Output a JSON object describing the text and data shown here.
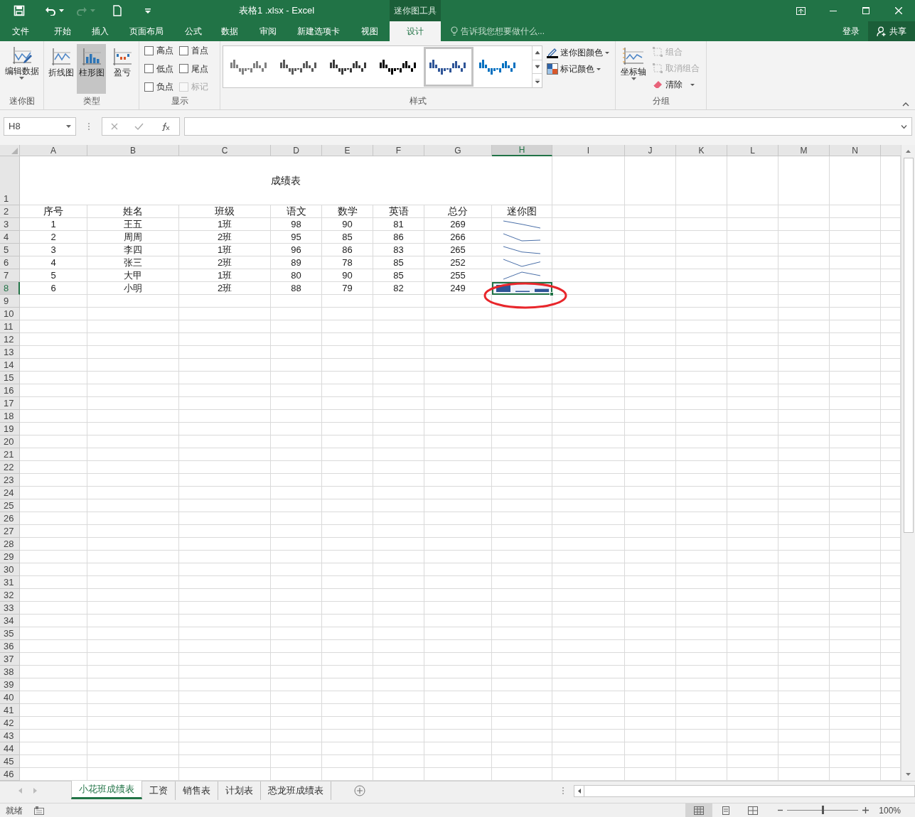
{
  "window": {
    "title": "表格1 .xlsx - Excel",
    "context_label": "迷你图工具"
  },
  "menu_tabs": [
    {
      "label": "文件",
      "selected": false
    },
    {
      "label": "开始",
      "selected": false
    },
    {
      "label": "插入",
      "selected": false
    },
    {
      "label": "页面布局",
      "selected": false
    },
    {
      "label": "公式",
      "selected": false
    },
    {
      "label": "数据",
      "selected": false
    },
    {
      "label": "审阅",
      "selected": false
    },
    {
      "label": "新建选项卡",
      "selected": false
    },
    {
      "label": "视图",
      "selected": false
    },
    {
      "label": "设计",
      "selected": true
    }
  ],
  "tell_me": {
    "placeholder": "告诉我您想要做什么..."
  },
  "account": {
    "sign_in": "登录",
    "share": "共享"
  },
  "ribbon": {
    "groups": [
      {
        "name": "迷你图",
        "kind": "data",
        "buttons": [
          {
            "label": "编辑数据"
          }
        ]
      },
      {
        "name": "类型",
        "kind": "type",
        "options": [
          {
            "label": "折线图",
            "selected": false
          },
          {
            "label": "柱形图",
            "selected": true
          },
          {
            "label": "盈亏",
            "selected": false
          }
        ]
      },
      {
        "name": "显示",
        "kind": "show",
        "checkboxes": [
          {
            "label": "高点",
            "checked": false,
            "disabled": false
          },
          {
            "label": "首点",
            "checked": false,
            "disabled": false
          },
          {
            "label": "低点",
            "checked": false,
            "disabled": false
          },
          {
            "label": "尾点",
            "checked": false,
            "disabled": false
          },
          {
            "label": "负点",
            "checked": false,
            "disabled": false
          },
          {
            "label": "标记",
            "checked": false,
            "disabled": true
          }
        ]
      },
      {
        "name": "样式",
        "kind": "style",
        "styles": [
          {
            "color": "#808080",
            "selected": false
          },
          {
            "color": "#595959",
            "selected": false
          },
          {
            "color": "#3a3a3a",
            "selected": false
          },
          {
            "color": "#000000",
            "selected": false
          },
          {
            "color": "#2f5597",
            "selected": true
          },
          {
            "color": "#0070c0",
            "selected": false
          }
        ],
        "buttons": [
          {
            "label": "迷你图颜色"
          },
          {
            "label": "标记颜色"
          }
        ]
      },
      {
        "name": "分组",
        "kind": "group",
        "axis": {
          "label": "坐标轴"
        },
        "buttons": [
          {
            "label": "组合",
            "disabled": true
          },
          {
            "label": "取消组合",
            "disabled": true
          },
          {
            "label": "清除",
            "disabled": false
          }
        ]
      }
    ]
  },
  "formula_bar": {
    "name_box": "H8"
  },
  "sheet": {
    "columns": [
      {
        "label": "A",
        "selected": false
      },
      {
        "label": "B",
        "selected": false
      },
      {
        "label": "C",
        "selected": false
      },
      {
        "label": "D",
        "selected": false
      },
      {
        "label": "E",
        "selected": false
      },
      {
        "label": "F",
        "selected": false
      },
      {
        "label": "G",
        "selected": false
      },
      {
        "label": "H",
        "selected": true
      },
      {
        "label": "I",
        "selected": false
      },
      {
        "label": "J",
        "selected": false
      },
      {
        "label": "K",
        "selected": false
      },
      {
        "label": "L",
        "selected": false
      },
      {
        "label": "M",
        "selected": false
      },
      {
        "label": "N",
        "selected": false
      }
    ],
    "row_numbers": [
      {
        "label": "1",
        "selected": false
      },
      {
        "label": "2",
        "selected": false
      },
      {
        "label": "3",
        "selected": false
      },
      {
        "label": "4",
        "selected": false
      },
      {
        "label": "5",
        "selected": false
      },
      {
        "label": "6",
        "selected": false
      },
      {
        "label": "7",
        "selected": false
      },
      {
        "label": "8",
        "selected": true
      },
      {
        "label": "9",
        "selected": false
      },
      {
        "label": "10",
        "selected": false
      },
      {
        "label": "11",
        "selected": false
      },
      {
        "label": "12",
        "selected": false
      },
      {
        "label": "13",
        "selected": false
      },
      {
        "label": "14",
        "selected": false
      },
      {
        "label": "15",
        "selected": false
      },
      {
        "label": "16",
        "selected": false
      },
      {
        "label": "17",
        "selected": false
      },
      {
        "label": "18",
        "selected": false
      },
      {
        "label": "19",
        "selected": false
      },
      {
        "label": "20",
        "selected": false
      },
      {
        "label": "21",
        "selected": false
      },
      {
        "label": "22",
        "selected": false
      },
      {
        "label": "23",
        "selected": false
      },
      {
        "label": "24",
        "selected": false
      },
      {
        "label": "25",
        "selected": false
      },
      {
        "label": "26",
        "selected": false
      },
      {
        "label": "27",
        "selected": false
      },
      {
        "label": "28",
        "selected": false
      },
      {
        "label": "29",
        "selected": false
      },
      {
        "label": "30",
        "selected": false
      },
      {
        "label": "31",
        "selected": false
      },
      {
        "label": "32",
        "selected": false
      },
      {
        "label": "33",
        "selected": false
      },
      {
        "label": "34",
        "selected": false
      },
      {
        "label": "35",
        "selected": false
      },
      {
        "label": "36",
        "selected": false
      },
      {
        "label": "37",
        "selected": false
      },
      {
        "label": "38",
        "selected": false
      },
      {
        "label": "39",
        "selected": false
      },
      {
        "label": "40",
        "selected": false
      },
      {
        "label": "41",
        "selected": false
      },
      {
        "label": "42",
        "selected": false
      },
      {
        "label": "43",
        "selected": false
      },
      {
        "label": "44",
        "selected": false
      },
      {
        "label": "45",
        "selected": false
      },
      {
        "label": "46",
        "selected": false
      }
    ],
    "title": "成绩表",
    "header": [
      "序号",
      "姓名",
      "班级",
      "语文",
      "数学",
      "英语",
      "总分",
      "迷你图"
    ],
    "rows": [
      {
        "cells": [
          "1",
          "王五",
          "1班",
          "98",
          "90",
          "81",
          "269"
        ],
        "sparkline": {
          "kind": "line",
          "active": false
        }
      },
      {
        "cells": [
          "2",
          "周周",
          "2班",
          "95",
          "85",
          "86",
          "266"
        ],
        "sparkline": {
          "kind": "line",
          "active": false
        }
      },
      {
        "cells": [
          "3",
          "李四",
          "1班",
          "96",
          "86",
          "83",
          "265"
        ],
        "sparkline": {
          "kind": "line",
          "active": false
        }
      },
      {
        "cells": [
          "4",
          "张三",
          "2班",
          "89",
          "78",
          "85",
          "252"
        ],
        "sparkline": {
          "kind": "line",
          "active": false
        }
      },
      {
        "cells": [
          "5",
          "大甲",
          "1班",
          "80",
          "90",
          "85",
          "255"
        ],
        "sparkline": {
          "kind": "line",
          "active": false
        }
      },
      {
        "cells": [
          "6",
          "小明",
          "2班",
          "88",
          "79",
          "82",
          "249"
        ],
        "sparkline": {
          "kind": "column",
          "active": true
        }
      }
    ],
    "highlight": {
      "color": "#e8262b"
    }
  },
  "sheet_tabs": [
    {
      "label": "小花班成绩表",
      "selected": true
    },
    {
      "label": "工资",
      "selected": false
    },
    {
      "label": "销售表",
      "selected": false
    },
    {
      "label": "计划表",
      "selected": false
    },
    {
      "label": "恐龙班成绩表",
      "selected": false
    }
  ],
  "status": {
    "text": "就绪",
    "views": [
      {
        "kind": "normal",
        "selected": true
      },
      {
        "kind": "page_layout",
        "selected": false
      },
      {
        "kind": "page_break",
        "selected": false
      }
    ],
    "zoom_slider": {
      "level": 0.5
    },
    "zoom": "100%"
  }
}
